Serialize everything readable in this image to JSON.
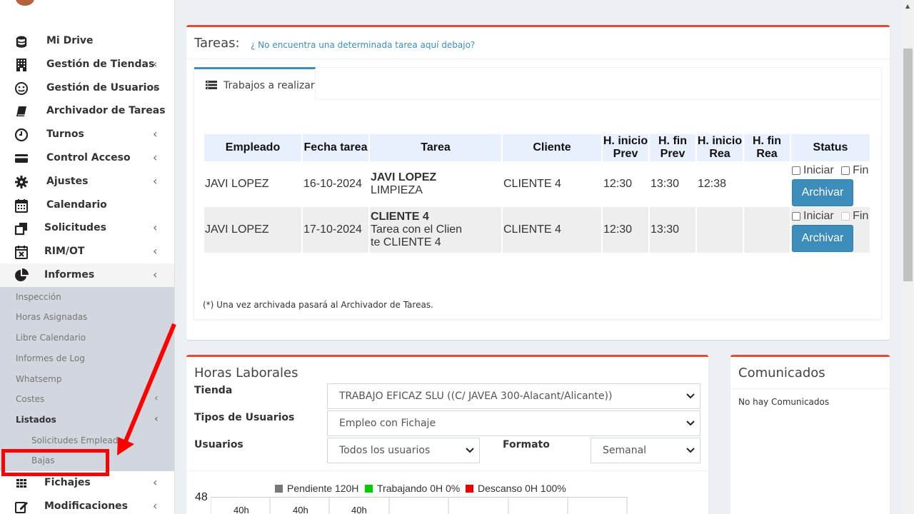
{
  "sidebar": {
    "items": [
      {
        "label": "Mi Drive",
        "icon": "database-icon",
        "chevron": false
      },
      {
        "label": "Gestión de Tiendas",
        "icon": "building-icon",
        "chevron": true
      },
      {
        "label": "Gestión de Usuarios",
        "icon": "smiley-icon",
        "chevron": true
      },
      {
        "label": "Archivador de Tareas",
        "icon": "book-icon",
        "chevron": false
      },
      {
        "label": "Turnos",
        "icon": "clock-icon",
        "chevron": true
      },
      {
        "label": "Control Acceso",
        "icon": "credit-card-icon",
        "chevron": true
      },
      {
        "label": "Ajustes",
        "icon": "gear-icon",
        "chevron": true
      },
      {
        "label": "Calendario",
        "icon": "calendar-icon",
        "chevron": false
      },
      {
        "label": "Solicitudes",
        "icon": "clone-icon",
        "chevron": true
      },
      {
        "label": "RIM/OT",
        "icon": "calendar-x-icon",
        "chevron": true
      },
      {
        "label": "Informes",
        "icon": "pie-chart-icon",
        "chevron": true
      }
    ],
    "sub_items": [
      {
        "label": "Inspección"
      },
      {
        "label": "Horas Asignadas"
      },
      {
        "label": "Libre Calendario"
      },
      {
        "label": "Informes de Log"
      },
      {
        "label": "Whatsemp"
      },
      {
        "label": "Costes",
        "chevron": true
      },
      {
        "label": "Listados",
        "chevron": true
      },
      {
        "label": "Solicitudes Empleado"
      },
      {
        "label": "Bajas"
      }
    ],
    "bottom_items": [
      {
        "label": "Fichajes",
        "icon": "grid-icon",
        "chevron": true
      },
      {
        "label": "Modificaciones",
        "icon": "edit-icon",
        "chevron": true
      }
    ],
    "chevron": "‹"
  },
  "tareas": {
    "title": "Tareas:",
    "help_link": "¿ No encuentra una determinada tarea aquí debajo?",
    "tab_label": "Trabajos a realizar",
    "headers": [
      "Empleado",
      "Fecha tarea",
      "Tarea",
      "Cliente",
      "H. inicio\nPrev",
      "H. fin\nPrev",
      "H. inicio\nRea",
      "H. fin\nRea",
      "Status"
    ],
    "rows": [
      {
        "empleado": "JAVI LOPEZ",
        "fecha": "16-10-2024",
        "tarea_title": "JAVI LOPEZ",
        "tarea_desc": "LIMPIEZA",
        "cliente": "CLIENTE 4",
        "hip": "12:30",
        "hfp": "13:30",
        "hir": "12:38",
        "hfr": ""
      },
      {
        "empleado": "JAVI LOPEZ",
        "fecha": "17-10-2024",
        "tarea_title": "CLIENTE 4",
        "tarea_desc": "Tarea con el Clien\nte CLIENTE 4",
        "cliente": "CLIENTE 4",
        "hip": "12:30",
        "hfp": "13:30",
        "hir": "",
        "hfr": ""
      }
    ],
    "iniciar_label": "Iniciar",
    "fin_label": "Fin",
    "archivar_label": "Archivar",
    "footnote": "(*) Una vez archivada pasará al Archivador de Tareas."
  },
  "horas": {
    "title": "Horas Laborales",
    "tienda_label": "Tienda",
    "tienda_value": "TRABAJO EFICAZ SLU ((C/ JAVEA 300-Alacant/Alicante))",
    "tipos_label": "Tipos de Usuarios",
    "tipos_value": "Empleo con Fichaje",
    "usuarios_label": "Usuarios",
    "usuarios_value": "Todos los usuarios",
    "formato_label": "Formato",
    "formato_value": "Semanal"
  },
  "chart_data": {
    "type": "bar",
    "series": [
      {
        "name": "Pendiente 120H",
        "color": "#777777"
      },
      {
        "name": "Trabajando 0H 0%",
        "color": "#00cc00"
      },
      {
        "name": "Descanso 0H 100%",
        "color": "#ee0000"
      }
    ],
    "y_top_label": "48",
    "bar_labels": [
      "40h",
      "40h",
      "40h"
    ]
  },
  "comunicados": {
    "title": "Comunicados",
    "empty": "No hay Comunicados"
  },
  "colors": {
    "accent": "#3c8dbc",
    "box_top": "#dd4b39",
    "annotation": "#ff0000"
  }
}
